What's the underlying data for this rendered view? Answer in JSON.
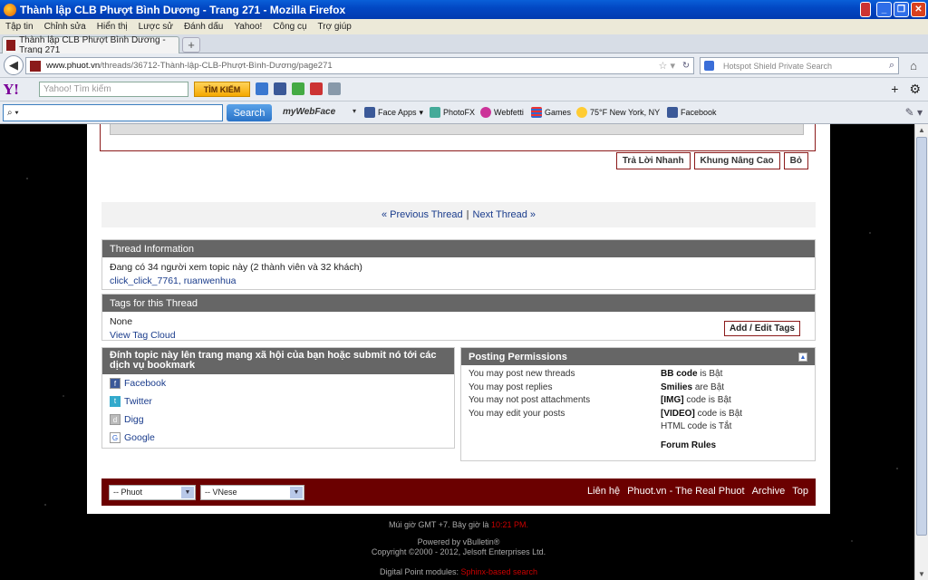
{
  "window": {
    "title": "Thành lập CLB Phượt Bình Dương - Trang 271 - Mozilla Firefox"
  },
  "menu": [
    "Tập tin",
    "Chỉnh sửa",
    "Hiển thị",
    "Lược sử",
    "Đánh dấu",
    "Yahoo!",
    "Công cụ",
    "Trợ giúp"
  ],
  "tab": {
    "title": "Thành lập CLB Phượt Bình Dương - Trang 271",
    "new_tab": "+"
  },
  "nav": {
    "url_domain": "www.phuot.vn",
    "url_path": "/threads/36712-Thành-lập-CLB-Phượt-Bình-Dương/page271",
    "search_placeholder": "Hotspot Shield Private Search"
  },
  "yahoo": {
    "logo": "Y!",
    "search_placeholder": "Yahoo! Tìm kiếm",
    "button": "TÌM KIẾM"
  },
  "links": {
    "search_button": "Search",
    "webface": "myWebFace",
    "items": [
      "Face Apps",
      "PhotoFX",
      "Webfetti",
      "Games",
      "75°F New York, NY",
      "Facebook"
    ]
  },
  "actions": {
    "quick_reply": "Trả Lời Nhanh",
    "advanced": "Khung Nâng Cao",
    "cancel": "Bỏ"
  },
  "threadnav": {
    "prev": "« Previous Thread",
    "sep": "|",
    "next": "Next Thread »"
  },
  "thread_info": {
    "title": "Thread Information",
    "viewers": "Đang có 34 người xem topic này (2 thành viên và 32 khách)",
    "users": "click_click_7761, ruanwenhua"
  },
  "tags": {
    "title": "Tags for this Thread",
    "none": "None",
    "cloud": "View Tag Cloud",
    "edit": "Add / Edit Tags"
  },
  "social": {
    "title": "Đính topic này lên trang mạng xã hội của bạn hoặc submit nó tới các dịch vụ bookmark",
    "items": [
      "Facebook",
      "Twitter",
      "Digg",
      "Google"
    ]
  },
  "permissions": {
    "title": "Posting Permissions",
    "left": [
      "You may post new threads",
      "You may post replies",
      "You may not post attachments",
      "You may edit your posts"
    ],
    "bbcode": {
      "label": "BB code",
      "state": "is Bật"
    },
    "smilies": {
      "label": "Smilies",
      "state": "are Bật"
    },
    "img": {
      "label": "[IMG]",
      "state": "code is Bật"
    },
    "video": {
      "label": "[VIDEO]",
      "state": "code is Bật"
    },
    "html": "HTML code is Tắt",
    "rules": "Forum Rules"
  },
  "footer": {
    "style_select": "-- Phuot",
    "lang_select": "-- VNese",
    "links": [
      "Liên hệ",
      "Phuot.vn - The Real Phuot",
      "Archive",
      "Top"
    ]
  },
  "bottom": {
    "time_prefix": "Múi giờ GMT +7. Bây giờ là",
    "time": "10:21 PM.",
    "powered": "Powered by vBulletin®",
    "copyright": "Copyright ©2000 - 2012, Jelsoft Enterprises Ltd.",
    "dp_prefix": "Digital Point modules:",
    "dp_link": "Sphinx-based search"
  }
}
